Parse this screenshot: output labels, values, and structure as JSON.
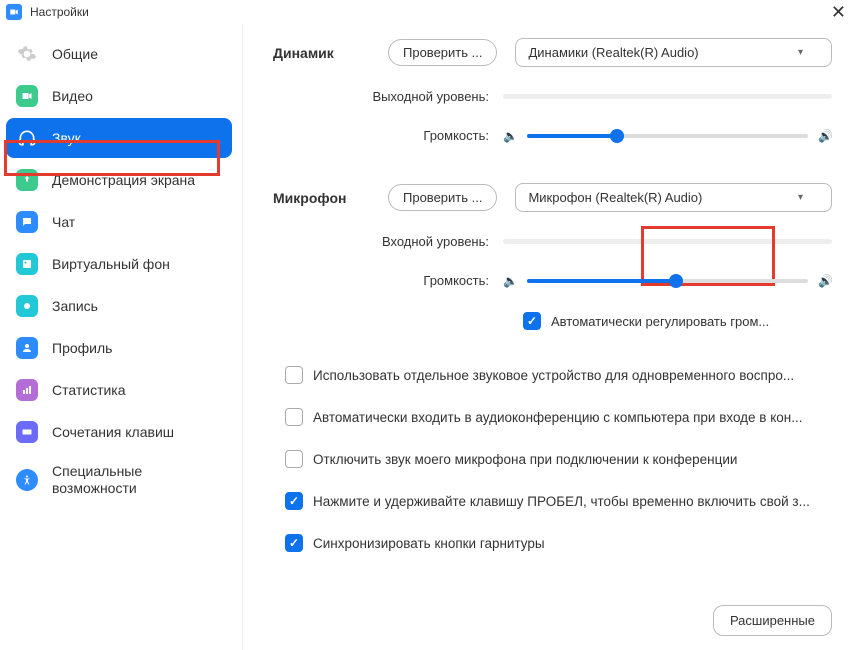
{
  "titlebar": {
    "title": "Настройки"
  },
  "sidebar": {
    "items": [
      {
        "label": "Общие"
      },
      {
        "label": "Видео"
      },
      {
        "label": "Звук"
      },
      {
        "label": "Демонстрация экрана"
      },
      {
        "label": "Чат"
      },
      {
        "label": "Виртуальный фон"
      },
      {
        "label": "Запись"
      },
      {
        "label": "Профиль"
      },
      {
        "label": "Статистика"
      },
      {
        "label": "Сочетания клавиш"
      },
      {
        "label": "Специальные возможности"
      }
    ]
  },
  "audio": {
    "speaker": {
      "section": "Динамик",
      "test": "Проверить ...",
      "device": "Динамики (Realtek(R) Audio)",
      "output_level_label": "Выходной уровень:",
      "volume_label": "Громкость:",
      "volume_percent": 32
    },
    "mic": {
      "section": "Микрофон",
      "test": "Проверить ...",
      "device": "Микрофон (Realtek(R) Audio)",
      "input_level_label": "Входной уровень:",
      "volume_label": "Громкость:",
      "volume_percent": 53,
      "auto_gain": "Автоматически регулировать гром..."
    },
    "options": [
      {
        "checked": false,
        "label": "Использовать отдельное звуковое устройство для одновременного воспро..."
      },
      {
        "checked": false,
        "label": "Автоматически входить в аудиоконференцию с компьютера при входе в кон..."
      },
      {
        "checked": false,
        "label": "Отключить звук моего микрофона при подключении к конференции"
      },
      {
        "checked": true,
        "label": "Нажмите и удерживайте клавишу ПРОБЕЛ, чтобы временно включить свой з..."
      },
      {
        "checked": true,
        "label": "Синхронизировать кнопки гарнитуры"
      }
    ],
    "advanced": "Расширенные"
  },
  "colors": {
    "accent": "#0E72EC",
    "highlight": "#E33B2E"
  }
}
